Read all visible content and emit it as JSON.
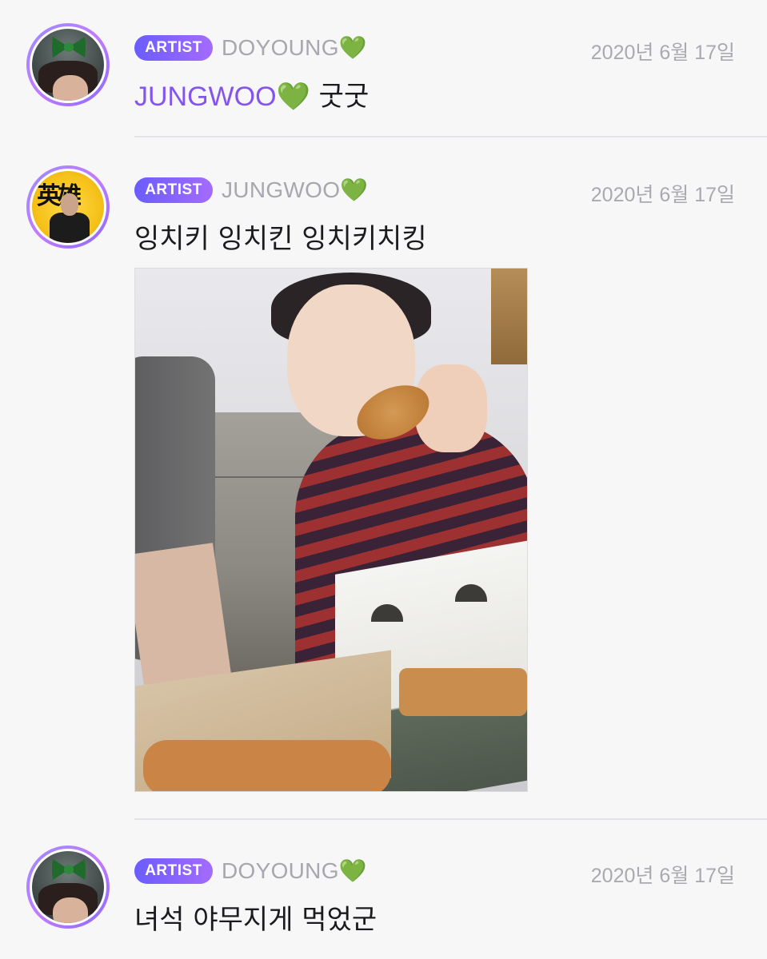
{
  "posts": [
    {
      "badge": "ARTIST",
      "author": "DOYOUNG💚",
      "date": "2020년 6월 17일",
      "mention": "JUNGWOO💚",
      "text": " 굿굿"
    },
    {
      "badge": "ARTIST",
      "author": "JUNGWOO💚",
      "date": "2020년 6월 17일",
      "text": "잉치키 잉치킨 잉치키치킹",
      "avatar_text": "英雄"
    },
    {
      "badge": "ARTIST",
      "author": "DOYOUNG💚",
      "date": "2020년 6월 17일",
      "text": "녀석 야무지게 먹었군"
    }
  ],
  "colors": {
    "background": "#f7f7f8",
    "badge_start": "#6a5cff",
    "badge_end": "#a46bff",
    "mention": "#8455ee",
    "meta_text": "#a7a7ad"
  },
  "icons": [
    "green-heart-icon"
  ]
}
